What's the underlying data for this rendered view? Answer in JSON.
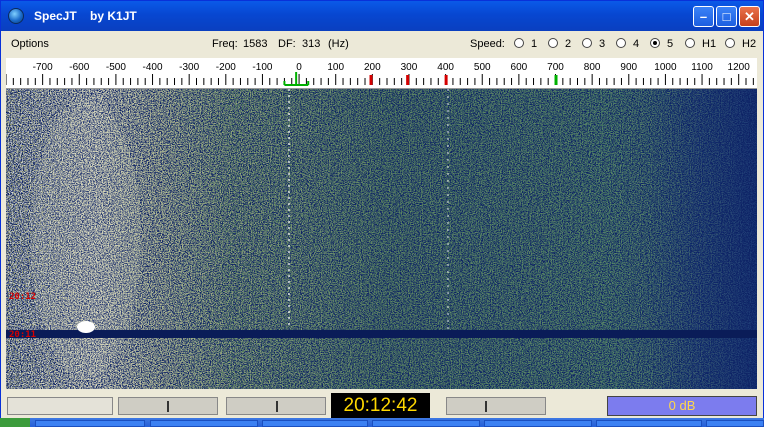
{
  "window": {
    "title": "SpecJT    by K1JT"
  },
  "menu": {
    "options": "Options"
  },
  "info": {
    "freq_label": "Freq:",
    "freq_value": "1583",
    "df_label": "DF:",
    "df_value": "313",
    "df_unit": "(Hz)"
  },
  "speed": {
    "label": "Speed:",
    "options": [
      "1",
      "2",
      "3",
      "4",
      "5",
      "H1",
      "H2"
    ],
    "selected": "5"
  },
  "scale": {
    "ticks": [
      "-700",
      "-600",
      "-500",
      "-400",
      "-300",
      "-200",
      "-100",
      "0",
      "100",
      "200",
      "300",
      "400",
      "500",
      "600",
      "700",
      "800",
      "900",
      "1000",
      "1100",
      "1200"
    ],
    "min": -800,
    "max": 1250,
    "marker_colors": {
      "red": "#d40000",
      "green": "#00b000"
    }
  },
  "waterfall": {
    "time_labels": [
      "20:12",
      "20:11"
    ]
  },
  "status": {
    "clock": "20:12:42",
    "level": "0 dB"
  }
}
